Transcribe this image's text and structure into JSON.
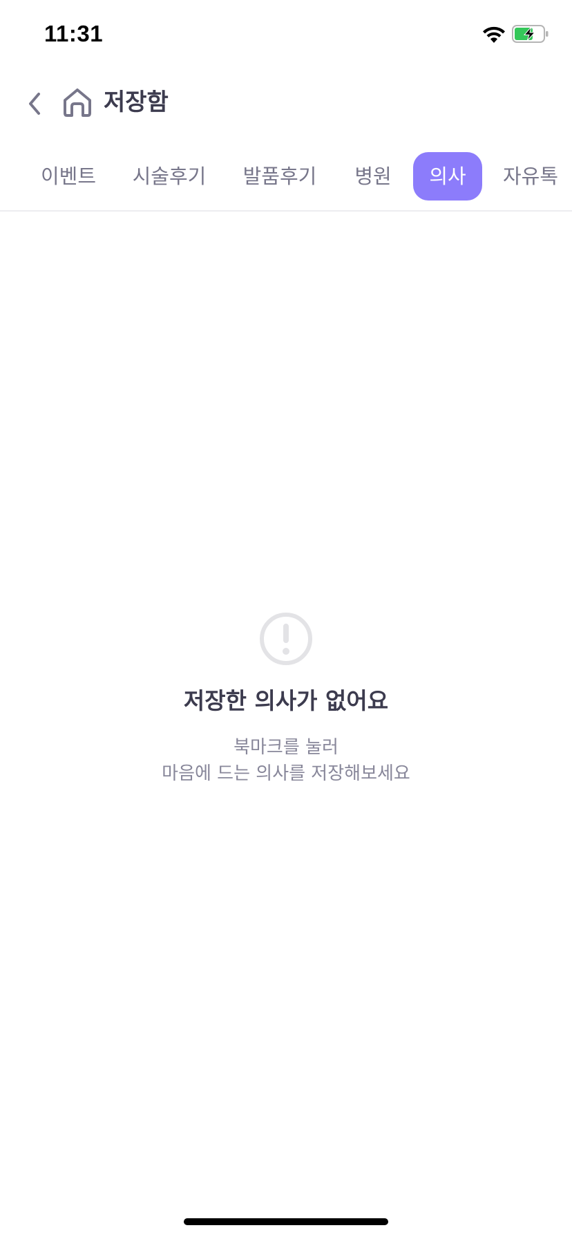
{
  "status_bar": {
    "time": "11:31"
  },
  "header": {
    "title": "저장함"
  },
  "tabs": [
    {
      "label": "이벤트",
      "active": false
    },
    {
      "label": "시술후기",
      "active": false
    },
    {
      "label": "발품후기",
      "active": false
    },
    {
      "label": "병원",
      "active": false
    },
    {
      "label": "의사",
      "active": true
    },
    {
      "label": "자유톡",
      "active": false
    }
  ],
  "empty_state": {
    "icon": "exclamation-circle-icon",
    "title": "저장한 의사가 없어요",
    "description_line1": "북마크를 눌러",
    "description_line2": "마음에 드는 의사를 저장해보세요"
  },
  "colors": {
    "accent": "#8c7cfb",
    "title_text": "#3c3b4e",
    "secondary_text": "#77768a",
    "battery_fill": "#34c759"
  }
}
